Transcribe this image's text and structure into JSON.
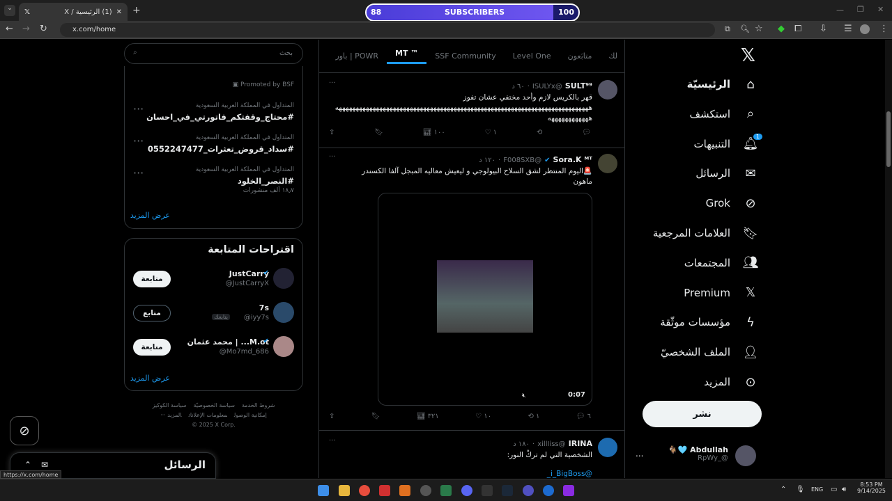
{
  "browser": {
    "tab_title": "(1) الرئيسية / X",
    "url": "x.com/home",
    "status_url": "https://x.com/home"
  },
  "subscribers_bar": {
    "label": "SUBSCRIBERS",
    "current": "88",
    "goal": "100",
    "progress": 0.88
  },
  "nav": {
    "items": [
      {
        "label": "الرئيسيّة",
        "icon": "home-icon"
      },
      {
        "label": "استكشف",
        "icon": "search-icon"
      },
      {
        "label": "التنبيهات",
        "icon": "bell-icon",
        "badge": "1"
      },
      {
        "label": "الرسائل",
        "icon": "mail-icon"
      },
      {
        "label": "Grok",
        "icon": "grok-icon"
      },
      {
        "label": "العلامات المرجعية",
        "icon": "bookmark-icon"
      },
      {
        "label": "المجتمعات",
        "icon": "communities-icon"
      },
      {
        "label": "Premium",
        "icon": "x-logo-icon"
      },
      {
        "label": "مؤسسات موثّقة",
        "icon": "lightning-icon"
      },
      {
        "label": "الملف الشخصيّ",
        "icon": "person-icon"
      },
      {
        "label": "المزيد",
        "icon": "more-circle-icon"
      }
    ],
    "post_label": "نشر",
    "account": {
      "name": "Abdullah 🩵🐐",
      "handle": "@_RpWy",
      "more": "..."
    }
  },
  "feed": {
    "tabs": [
      "لك",
      "متابَعون",
      "Level One",
      "SSF Community",
      "MT ™",
      "باور | POWR"
    ],
    "active_tab": "MT ™",
    "tweets": [
      {
        "name": "SULT⁹⁹",
        "handle": "@ISULYx",
        "time": "٦٠ د",
        "text": "قهر بالكريس لازم وأحد مختفي عشان تفوز",
        "text2": "هههههههههههههههههههههههههههههههههههههههههههههههههههههههههههههههههههههههههههه",
        "text3": "ههههههههههههه",
        "replies": "",
        "retweets": "",
        "likes": "١",
        "views": "١٠٠"
      },
      {
        "name": "Sora.K ᴹᵀ",
        "handle": "@F008SXB",
        "time": "١٢٠ د",
        "text": "🚨اليوم المنتظر لشق السلاح البيولوجي و ليعيش معاليه المبجل آلفا الكسندر ماهون",
        "video_duration": "0:07",
        "replies": "٦",
        "retweets": "١",
        "likes": "١٠",
        "views": "٣٢١"
      },
      {
        "name": "IRINA",
        "handle": "@xillIiss",
        "time": "١٨٠ د",
        "text": "الشخصية التي لم تركْ النور:",
        "mention": "@i_BigBoss_"
      }
    ]
  },
  "sidebar": {
    "search_placeholder": "بحث",
    "promoted_text": "Promoted by BSF",
    "trends": [
      {
        "meta": "المتداول في المملكة العربية السعودية",
        "name": "#محتاج_وقفتكم_فاتورتي_في_احسان"
      },
      {
        "meta": "المتداول في المملكة العربية السعودية",
        "name": "#سداد_قروض_تعثرات_0552247477"
      },
      {
        "meta": "المتداول في المملكة العربية السعودية",
        "name": "#النصر_الخلود",
        "posts": "١٨٫٧ ألف منشورات"
      }
    ],
    "show_more": "عرض المزيد",
    "who_to_follow": {
      "title": "اقتراحات المتابعة",
      "users": [
        {
          "name": "JustCarry",
          "handle": "@JustCarryX",
          "button": "متابعة",
          "verified": true
        },
        {
          "name": "7s",
          "handle": "@iyy7s",
          "follows_you": "يتابعك",
          "button": "متابع",
          "verified": false
        },
        {
          "name": "M.ot... | محمد عثمان",
          "handle": "@Mo7md_686",
          "button": "متابعة",
          "verified": true
        }
      ],
      "show_more": "عرض المزيد"
    },
    "footer": {
      "line1": [
        "شروط الخدمة",
        "سياسة الخصوصيّة",
        "سياسة الكوكيز"
      ],
      "line2": [
        "إمكانية الوصول",
        "معلومات الإعلانات",
        "المزيد ···"
      ],
      "copyright": "© 2025 X Corp."
    }
  },
  "messages_drawer": {
    "title": "الرسائل"
  },
  "taskbar": {
    "lang": "ENG",
    "time": "8:53 PM",
    "date": "9/14/2025"
  },
  "colors": {
    "accent": "#1d9bf0",
    "background": "#000000",
    "border": "#2f3336",
    "sub_bar": "#5b48e6"
  }
}
